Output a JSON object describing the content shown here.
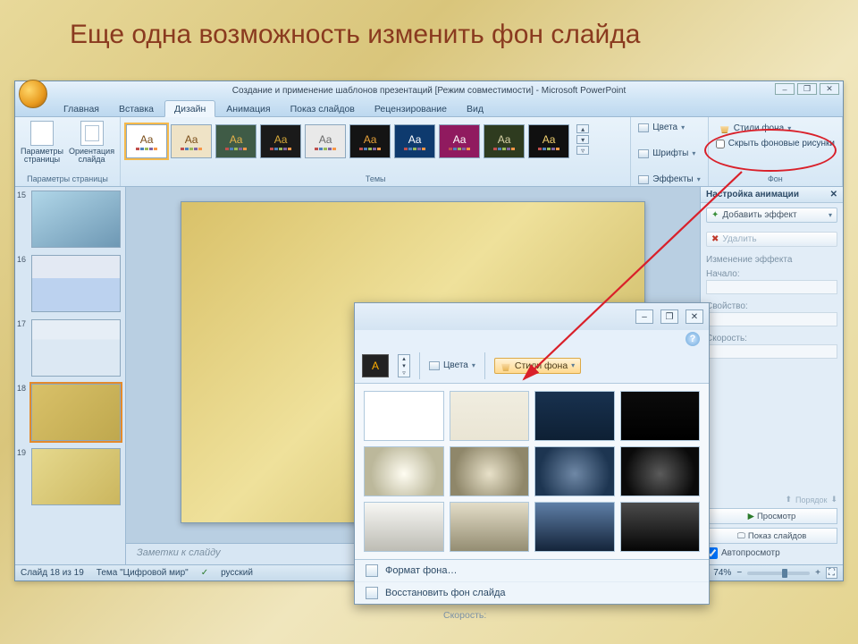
{
  "slide_title": "Еще одна возможность изменить фон слайда",
  "app": {
    "titlebar": "Создание и применение шаблонов презентаций [Режим совместимости] - Microsoft PowerPoint",
    "tabs": [
      "Главная",
      "Вставка",
      "Дизайн",
      "Анимация",
      "Показ слайдов",
      "Рецензирование",
      "Вид"
    ],
    "active_tab_index": 2
  },
  "ribbon": {
    "page_setup": {
      "params_label": "Параметры\nстраницы",
      "orient_label": "Ориентация\nслайда",
      "group_label": "Параметры страницы"
    },
    "themes_group_label": "Темы",
    "themes": [
      {
        "bg": "#ffffff",
        "fg": "#7a4d18"
      },
      {
        "bg": "#efe3c6",
        "fg": "#7a4d18"
      },
      {
        "bg": "#3f5b46",
        "fg": "#e6b24a"
      },
      {
        "bg": "#1a1a1a",
        "fg": "#d6a93a"
      },
      {
        "bg": "#e9e9e9",
        "fg": "#6a6a6a"
      },
      {
        "bg": "#141414",
        "fg": "#e6a23a"
      },
      {
        "bg": "#0e3a6e",
        "fg": "#ffffff"
      },
      {
        "bg": "#901a5f",
        "fg": "#ffffff"
      },
      {
        "bg": "#2e3b1f",
        "fg": "#d8d2a6"
      },
      {
        "bg": "#101010",
        "fg": "#f0d070"
      }
    ],
    "right_panel": {
      "colors_label": "Цвета",
      "fonts_label": "Шрифты",
      "effects_label": "Эффекты"
    },
    "bg_group": {
      "styles_label": "Стили фона",
      "hide_label": "Скрыть фоновые рисунки",
      "group_label": "Фон"
    }
  },
  "thumbnails": [
    {
      "num": "15",
      "sel": false,
      "bg": "linear-gradient(150deg,#b0d6e8,#6e98b4)"
    },
    {
      "num": "16",
      "sel": false,
      "bg": "linear-gradient(180deg,#e3e9f3 40%,#bcd2ef 40%)"
    },
    {
      "num": "17",
      "sel": false,
      "bg": "linear-gradient(180deg,#e6eef6 35%,#dce8f3 35%)"
    },
    {
      "num": "18",
      "sel": true,
      "bg": "linear-gradient(135deg,#d9c169,#bfa84e)"
    },
    {
      "num": "19",
      "sel": false,
      "bg": "linear-gradient(135deg,#e6d98e,#cbb65e)"
    }
  ],
  "notes_placeholder": "Заметки к слайду",
  "task_pane": {
    "title": "Настройка анимации",
    "add_effect": "Добавить эффект",
    "remove": "Удалить",
    "change_effect": "Изменение эффекта",
    "start_label": "Начало:",
    "property_label": "Свойство:",
    "speed_label": "Скорость:",
    "reorder_label": "Порядок",
    "play": "Просмотр",
    "slideshow": "Показ слайдов",
    "autopreview": "Автопросмотр"
  },
  "statusbar": {
    "slide_info": "Слайд 18 из 19",
    "theme": "Тема \"Цифровой мир\"",
    "lang": "русский",
    "zoom": "74%"
  },
  "popup": {
    "colors_label": "Цвета",
    "styles_btn": "Стили фона",
    "gallery": [
      "linear-gradient(#ffffff,#ffffff)",
      "linear-gradient(#f0ede0,#eae5d4)",
      "linear-gradient(#18314f,#0e2034)",
      "linear-gradient(#0b0b0b,#000000)",
      "radial-gradient(circle at 50% 55%, #fffdf2 0%, #bcb89b 70%)",
      "radial-gradient(circle at 50% 55%, #e8e1c9 0%, #8f876a 75%)",
      "radial-gradient(circle at 50% 55%, #6f88a6 0%, #1d3551 75%)",
      "radial-gradient(circle at 50% 55%, #5b5b5b 0%, #0a0a0a 75%)",
      "linear-gradient(180deg,#f7f7f4 0%,#bdbcb4 100%)",
      "linear-gradient(180deg,#e3ddc8 0%,#948d72 100%)",
      "linear-gradient(180deg,#5e7ea6 0%,#14243a 100%)",
      "linear-gradient(180deg,#4b4b4b 0%,#050505 100%)"
    ],
    "format_bg": "Формат фона…",
    "reset_bg": "Восстановить фон слайда"
  },
  "speed_stub": "Скорость:"
}
